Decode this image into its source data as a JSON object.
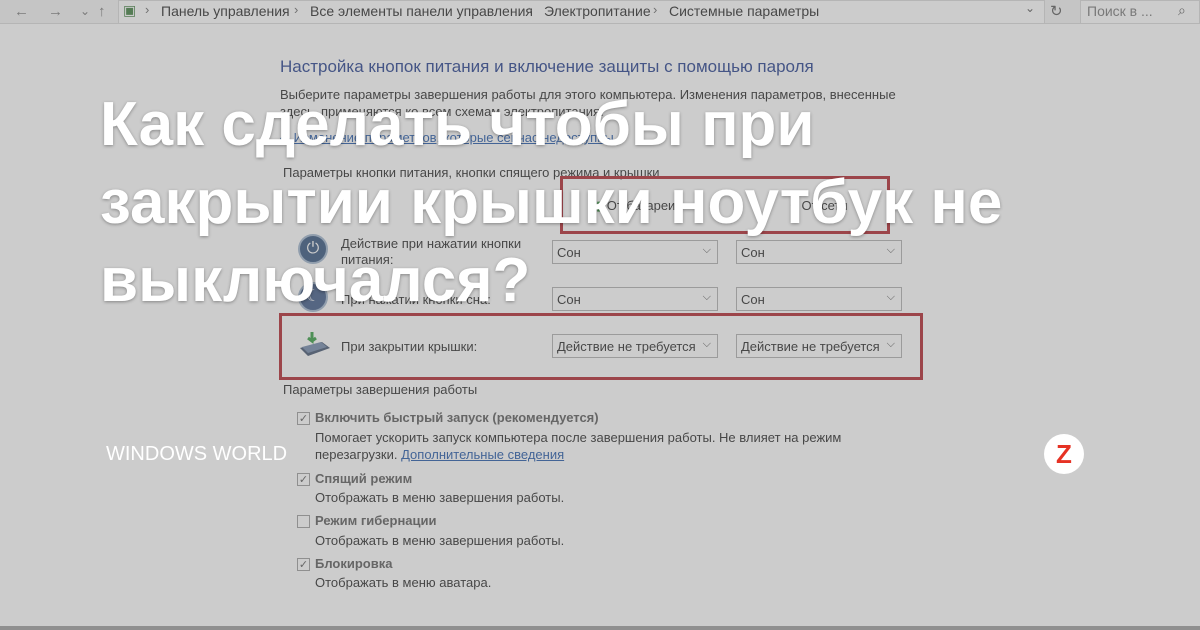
{
  "nav": {
    "back_icon": "←",
    "forward_icon": "→",
    "down_icon": "⌄",
    "up_icon": "↑",
    "breadcrumbs": [
      "Панель управления",
      "Все элементы панели управления",
      "Электропитание",
      "Системные параметры"
    ],
    "search_placeholder": "Поиск в ...",
    "refresh_icon": "↻",
    "dropdown_icon": "⌄",
    "search_icon": "⌕"
  },
  "page": {
    "heading": "Настройка кнопок питания и включение защиты с помощью пароля",
    "intro_line1": "Выберите параметры завершения работы для этого компьютера. Изменения параметров, внесенные",
    "intro_line2": "здесь, применяются ко всем схемам электропитания.",
    "change_link": "Изменение параметров, которые сейчас недоступны",
    "power_section_label": "Параметры кнопки питания, кнопки спящего режима и крышки",
    "col_battery": "От батареи",
    "col_plugged": "От сети",
    "rows": [
      {
        "label": "Действие при нажатии кнопки питания:",
        "battery": "Сон",
        "plugged": "Сон"
      },
      {
        "label": "При нажатии кнопки сна:",
        "battery": "Сон",
        "plugged": "Сон"
      },
      {
        "label": "При закрытии крышки:",
        "battery": "Действие не требуется",
        "plugged": "Действие не требуется"
      }
    ],
    "shutdown_section_label": "Параметры завершения работы",
    "options": [
      {
        "title": "Включить быстрый запуск (рекомендуется)",
        "checked": true,
        "desc1": "Помогает ускорить запуск компьютера после завершения работы. Не влияет на режим",
        "desc2": "перезагрузки.",
        "link": "Дополнительные сведения"
      },
      {
        "title": "Спящий режим",
        "checked": true,
        "desc1": "Отображать в меню завершения работы."
      },
      {
        "title": "Режим гибернации",
        "checked": false,
        "desc1": "Отображать в меню завершения работы."
      },
      {
        "title": "Блокировка",
        "checked": true,
        "desc1": "Отображать в меню аватара."
      }
    ]
  },
  "overlay": {
    "title": "Как сделать чтобы при закрытии крышки ноутбук не выключался?",
    "brand": "WINDOWS WORLD",
    "logo_letter": "Z"
  },
  "colors": {
    "highlight": "#b01e27",
    "heading": "#1e3a8a",
    "link": "#1c53a6",
    "logo": "#e63224"
  }
}
